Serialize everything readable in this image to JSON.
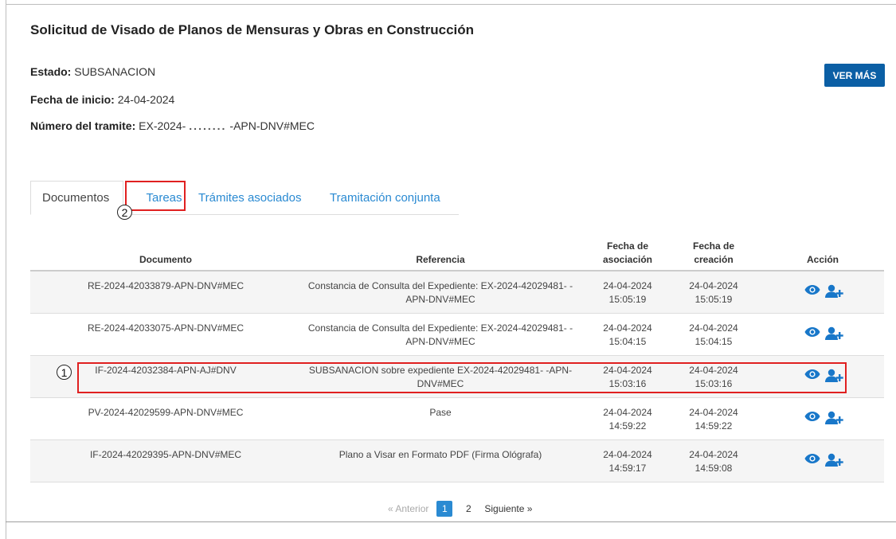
{
  "page": {
    "title": "Solicitud de Visado de Planos de Mensuras y Obras en Construcción"
  },
  "info": {
    "estado_label": "Estado:",
    "estado_value": "SUBSANACION",
    "fecha_label": "Fecha de inicio:",
    "fecha_value": "24-04-2024",
    "numero_label": "Número del tramite:",
    "numero_prefix": "EX-2024-",
    "numero_redacted": "........",
    "numero_suffix": "-APN-DNV#MEC"
  },
  "buttons": {
    "ver_mas": "VER MÁS"
  },
  "tabs": [
    {
      "label": "Documentos",
      "active": true
    },
    {
      "label": "Tareas",
      "active": false
    },
    {
      "label": "Trámites asociados",
      "active": false
    },
    {
      "label": "Tramitación conjunta",
      "active": false
    }
  ],
  "annotations": {
    "marker_1": "1",
    "marker_2": "2"
  },
  "table": {
    "headers": {
      "documento": "Documento",
      "referencia": "Referencia",
      "fecha_asociacion_1": "Fecha de",
      "fecha_asociacion_2": "asociación",
      "fecha_creacion_1": "Fecha de",
      "fecha_creacion_2": "creación",
      "accion": "Acción"
    },
    "rows": [
      {
        "documento": "RE-2024-42033879-APN-DNV#MEC",
        "ref1": "Constancia de Consulta del Expediente: EX-2024-42029481- -",
        "ref2": "APN-DNV#MEC",
        "asoc_fecha": "24-04-2024",
        "asoc_hora": "15:05:19",
        "crea_fecha": "24-04-2024",
        "crea_hora": "15:05:19"
      },
      {
        "documento": "RE-2024-42033075-APN-DNV#MEC",
        "ref1": "Constancia de Consulta del Expediente: EX-2024-42029481- -",
        "ref2": "APN-DNV#MEC",
        "asoc_fecha": "24-04-2024",
        "asoc_hora": "15:04:15",
        "crea_fecha": "24-04-2024",
        "crea_hora": "15:04:15"
      },
      {
        "documento": "IF-2024-42032384-APN-AJ#DNV",
        "ref1": "SUBSANACION sobre expediente EX-2024-42029481- -APN-",
        "ref2": "DNV#MEC",
        "asoc_fecha": "24-04-2024",
        "asoc_hora": "15:03:16",
        "crea_fecha": "24-04-2024",
        "crea_hora": "15:03:16"
      },
      {
        "documento": "PV-2024-42029599-APN-DNV#MEC",
        "ref1": "Pase",
        "ref2": "",
        "asoc_fecha": "24-04-2024",
        "asoc_hora": "14:59:22",
        "crea_fecha": "24-04-2024",
        "crea_hora": "14:59:22"
      },
      {
        "documento": "IF-2024-42029395-APN-DNV#MEC",
        "ref1": "Plano a Visar en Formato PDF (Firma Ológrafa)",
        "ref2": "",
        "asoc_fecha": "24-04-2024",
        "asoc_hora": "14:59:17",
        "crea_fecha": "24-04-2024",
        "crea_hora": "14:59:08"
      }
    ]
  },
  "pagination": {
    "prev": "« Anterior",
    "pages": [
      "1",
      "2"
    ],
    "next": "Siguiente »"
  },
  "colors": {
    "link": "#2a8ad2",
    "button": "#0b5fa5",
    "annotation": "#e02020"
  }
}
